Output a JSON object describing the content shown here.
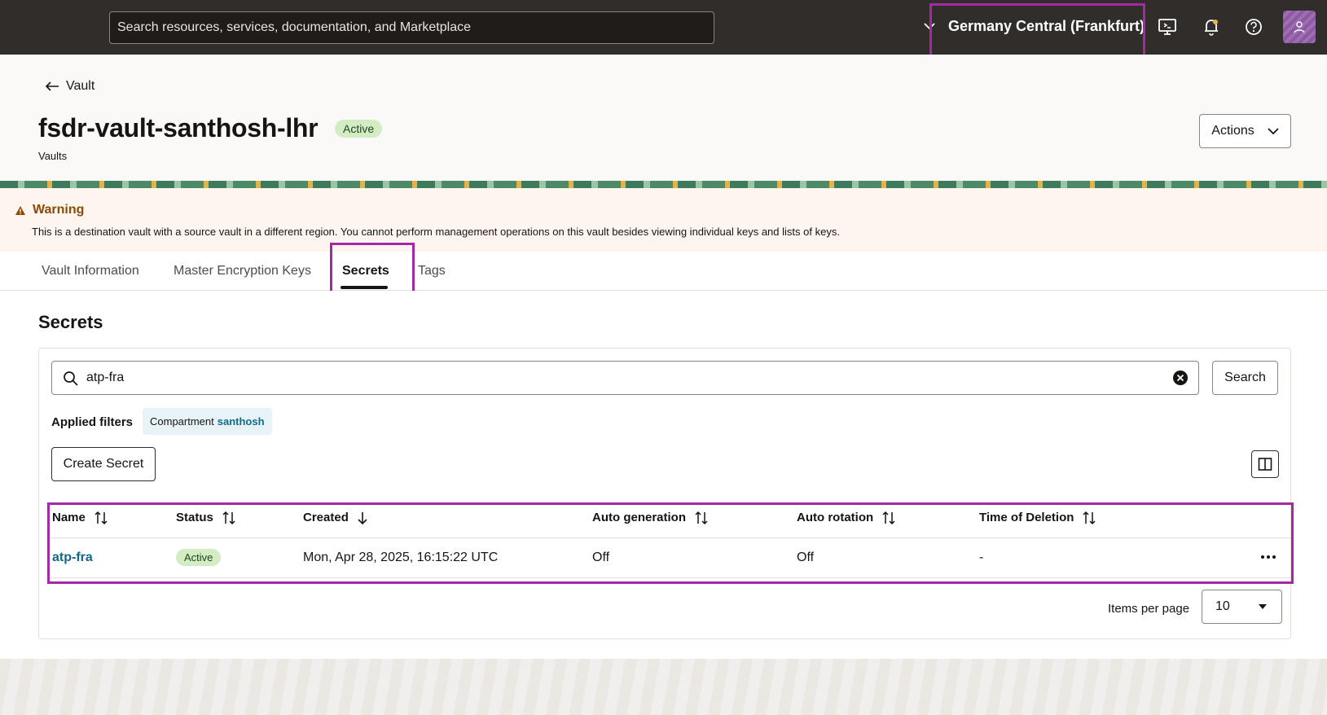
{
  "topbar": {
    "search_placeholder": "Search resources, services, documentation, and Marketplace",
    "region": "Germany Central (Frankfurt)"
  },
  "header": {
    "back_label": "Vault",
    "title": "fsdr-vault-santhosh-lhr",
    "status": "Active",
    "subtitle": "Vaults",
    "actions_label": "Actions"
  },
  "warning": {
    "title": "Warning",
    "text": "This is a destination vault with a source vault in a different region. You cannot perform management operations on this vault besides viewing individual keys and lists of keys."
  },
  "tabs": [
    {
      "label": "Vault Information"
    },
    {
      "label": "Master Encryption Keys"
    },
    {
      "label": "Secrets"
    },
    {
      "label": "Tags"
    }
  ],
  "secrets": {
    "title": "Secrets",
    "search_value": "atp-fra",
    "search_button": "Search",
    "applied_filters_label": "Applied filters",
    "filter_key": "Compartment",
    "filter_value": "santhosh",
    "create_button": "Create Secret",
    "columns": [
      "Name",
      "Status",
      "Created",
      "Auto generation",
      "Auto rotation",
      "Time of Deletion"
    ],
    "rows": [
      {
        "name": "atp-fra",
        "status": "Active",
        "created": "Mon, Apr 28, 2025, 16:15:22 UTC",
        "auto_generation": "Off",
        "auto_rotation": "Off",
        "time_of_deletion": "-"
      }
    ],
    "items_per_page_label": "Items per page",
    "items_per_page": "10"
  },
  "colors": {
    "topbar": "#312d2a",
    "highlight": "#a428a8",
    "link": "#106b8a",
    "badge_bg": "#d4ecc4"
  }
}
